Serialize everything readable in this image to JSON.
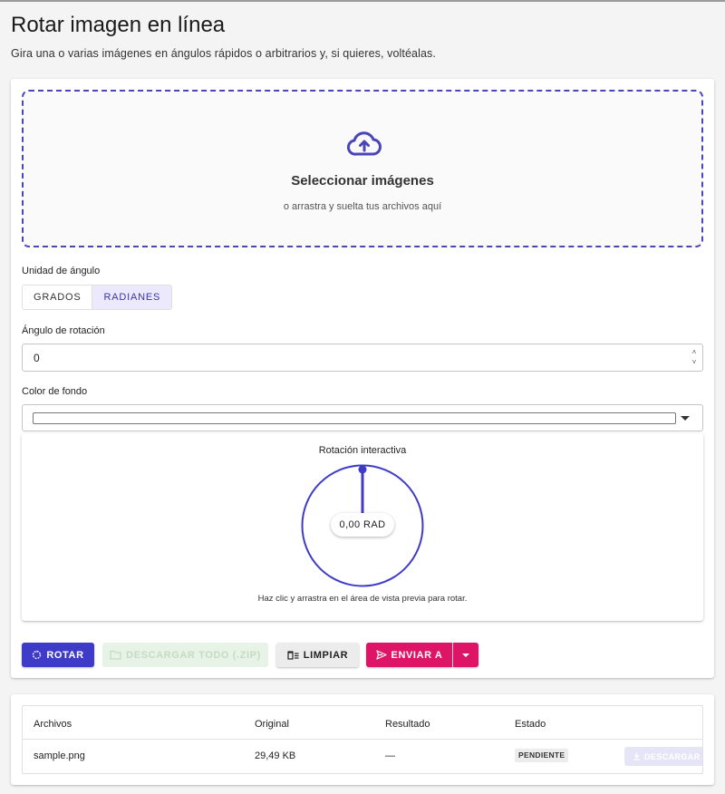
{
  "page": {
    "title": "Rotar imagen en línea",
    "subtitle": "Gira una o varias imágenes en ángulos rápidos o arbitrarios y, si quieres, voltéalas."
  },
  "dropzone": {
    "title": "Seleccionar imágenes",
    "hint": "o arrastra y suelta tus archivos aquí",
    "icon": "cloud-upload-icon"
  },
  "angle_unit": {
    "label": "Unidad de ángulo",
    "options": [
      "GRADOS",
      "RADIANES"
    ],
    "selected": "RADIANES"
  },
  "rotation_angle": {
    "label": "Ángulo de rotación",
    "value": "0"
  },
  "background_color": {
    "label": "Color de fondo",
    "value": "#ffffff"
  },
  "preview": {
    "title": "Rotación interactiva",
    "readout": "0,00 RAD",
    "angle": 0,
    "hint": "Haz clic y arrastra en el área de vista previa para rotar."
  },
  "actions": {
    "rotate": "ROTAR",
    "download_all": "DESCARGAR TODO (.ZIP)",
    "clear": "LIMPIAR",
    "send_to": "ENVIAR A"
  },
  "files_table": {
    "headers": [
      "Archivos",
      "Original",
      "Resultado",
      "Estado"
    ],
    "rows": [
      {
        "name": "sample.png",
        "original": "29,49 KB",
        "result": "—",
        "status": "PENDIENTE",
        "download": "DESCARGAR"
      }
    ]
  },
  "colors": {
    "primary": "#3f3bc9",
    "accent": "#de1566",
    "dropzone_border": "#4a46b8"
  }
}
